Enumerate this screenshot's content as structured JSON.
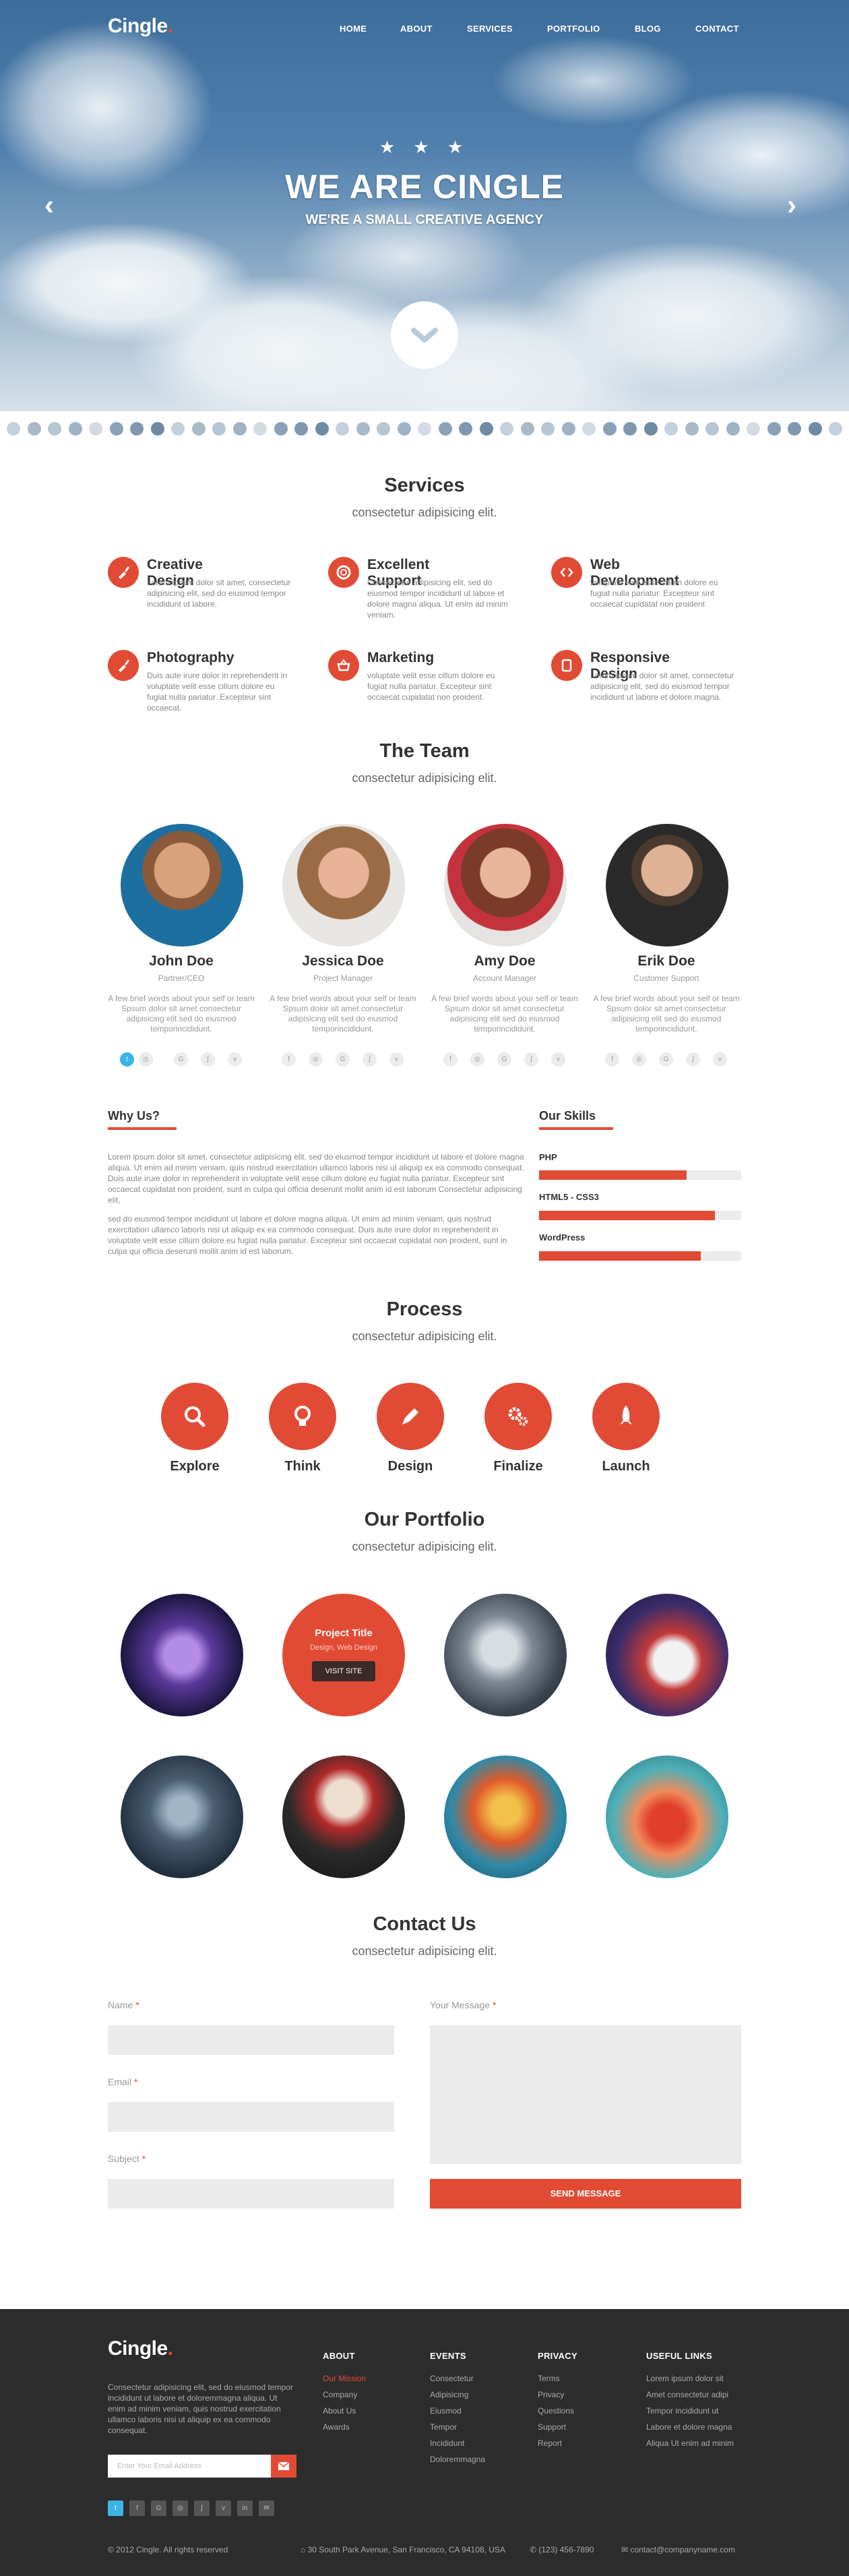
{
  "nav": {
    "logo": "Cingle",
    "logo_dot": ".",
    "items": [
      "HOME",
      "ABOUT",
      "SERVICES",
      "PORTFOLIO",
      "BLOG",
      "CONTACT"
    ]
  },
  "hero": {
    "stars": "★ ★ ★",
    "title": "WE ARE CINGLE",
    "subtitle": "WE'RE A SMALL CREATIVE AGENCY",
    "prev": "‹",
    "next": "›"
  },
  "services": {
    "title": "Services",
    "subtitle": "consectetur adipisicing elit.",
    "items": [
      {
        "title": "Creative Design",
        "text": "Lorem ipsum dolor sit amet, consectetur adipisicing elit, sed do eiusmod tempor incididunt ut labore.",
        "icon": "brush-icon"
      },
      {
        "title": "Excellent Support",
        "text": "Consectetur adipisicing elit, sed do eiusmod tempor incididunt ut labore et dolore magna aliqua. Ut enim ad minim veniam.",
        "icon": "lifebuoy-icon"
      },
      {
        "title": "Web Development",
        "text": "voluptate velit esse cillum dolore eu fugiat nulla pariatur. Excepteur sint occaecat cupidatat non proident",
        "icon": "code-icon"
      },
      {
        "title": "Photography",
        "text": "Duis aute irure dolor in reprehenderit in voluptate velit esse cillum dolore eu fugiat nulla pariatur. Excepteur sint occaecat.",
        "icon": "camera-icon"
      },
      {
        "title": "Marketing",
        "text": "voluptate velit esse cillum dolore eu fugiat nulla pariatur. Excepteur sint occaecat cupidatat non proident.",
        "icon": "basket-icon"
      },
      {
        "title": "Responsive Design",
        "text": "Lorem ipsum dolor sit amet, consectetur adipisicing elit, sed do eiusmod tempor incididunt ut labore et dolore magna.",
        "icon": "tablet-icon"
      }
    ]
  },
  "team": {
    "title": "The Team",
    "subtitle": "consectetur adipisicing elit.",
    "members": [
      {
        "name": "John Doe",
        "role": "Partner/CEO",
        "bio": "A few brief words about your self or team Spsum dolor sit amet consectetur adipisicing elit sed do eiusmod temporincididunt."
      },
      {
        "name": "Jessica Doe",
        "role": "Project Manager",
        "bio": "A few brief words about your self or team Spsum dolor sit amet consectetur adipisicing elit sed do eiusmod temporincididunt."
      },
      {
        "name": "Amy Doe",
        "role": "Account Manager",
        "bio": "A few brief words about your self or team Spsum dolor sit amet consectetur adipisicing elit sed do eiusmod temporincididunt."
      },
      {
        "name": "Erik Doe",
        "role": "Customer Support",
        "bio": "A few brief words about your self or team Spsum dolor sit amet consectetur adipisicing elit sed do eiusmod temporincididunt."
      }
    ],
    "social": [
      "t",
      "f",
      "◎",
      "G",
      "ʃ",
      "v"
    ]
  },
  "why": {
    "title": "Why Us?",
    "p1": "Lorem ipsum dolor sit amet, consectetur adipisicing elit, sed do eiusmod tempor incididunt ut labore et dolore magna aliqua. Ut enim ad minim veniam, quis nostrud exercitation ullamco laboris nisi ut aliquip ex ea commodo consequat. Duis aute irure dolor in reprehenderit in voluptate velit esse cillum dolore eu fugiat nulla pariatur. Excepteur sint occaecat cupidatat non proident, sunt in culpa qui officia deserunt mollit anim id est laborum Consectetur adipisicing elit,",
    "p2": "sed do eiusmod tempor incididunt ut labore et dolore magna aliqua. Ut enim ad minim veniam, quis nostrud exercitation ullamco laboris nisi ut aliquip ex ea commodo consequat. Duis aute irure dolor in reprehenderit in voluptate velit esse cillum dolore eu fugiat nulla pariatur. Excepteur sint occaecat cupidatat non proident, sunt in culpa qui officia deserunt mollit anim id est laborum."
  },
  "skills": {
    "title": "Our Skills",
    "items": [
      {
        "label": "PHP",
        "level": 0.73
      },
      {
        "label": "HTML5 - CSS3",
        "level": 0.87
      },
      {
        "label": "WordPress",
        "level": 0.8
      }
    ]
  },
  "process": {
    "title": "Process",
    "subtitle": "consectetur adipisicing elit.",
    "steps": [
      {
        "label": "Explore",
        "icon": "search-icon"
      },
      {
        "label": "Think",
        "icon": "lightbulb-icon"
      },
      {
        "label": "Design",
        "icon": "pen-icon"
      },
      {
        "label": "Finalize",
        "icon": "gears-icon"
      },
      {
        "label": "Launch",
        "icon": "rocket-icon"
      }
    ]
  },
  "portfolio": {
    "title": "Our Portfolio",
    "subtitle": "consectetur adipisicing elit.",
    "hover_title": "Project Title",
    "hover_sub": "Design, Web Design",
    "hover_btn": "VISIT SITE"
  },
  "contact": {
    "title": "Contact Us",
    "subtitle": "consectetur adipisicing elit.",
    "name_label": "Name",
    "email_label": "Email",
    "subject_label": "Subject",
    "message_label": "Your Message",
    "required": "*",
    "send": "SEND MESSAGE"
  },
  "footer": {
    "logo": "Cingle",
    "logo_dot": ".",
    "about_text": "Consectetur adipisicing elit, sed do eiusmod tempor incididunt ut labore et doloremmagna aliqua. Ut enim ad minim veniam, quis nostrud exercitation ullamco laboris nisi ut aliquip ex ea commodo consequat.",
    "email_placeholder": "Enter Your Email Address",
    "cols": [
      {
        "title": "ABOUT",
        "links": [
          "Our Mission",
          "Company",
          "About Us",
          "Awards"
        ]
      },
      {
        "title": "EVENTS",
        "links": [
          "Consectetur",
          "Adipisicing",
          "Eiusmod",
          "Tempor",
          "Incididunt",
          "Doloremmagna"
        ]
      },
      {
        "title": "PRIVACY",
        "links": [
          "Terms",
          "Privacy",
          "Questions",
          "Support",
          "Report"
        ]
      },
      {
        "title": "USEFUL LINKS",
        "links": [
          "Lorem ipsum dolor sit",
          "Amet consectetur adipi",
          "Tempor incididunt ut",
          "Labore et dolore magna",
          "Aliqua Ut enim ad minim"
        ]
      }
    ],
    "social": [
      "t",
      "f",
      "G",
      "◎",
      "ʃ",
      "v",
      "in",
      "✉"
    ],
    "copyright": "© 2012 Cingle. All rights reserved",
    "address": "30 South Park Avenue, San Francisco, CA 94108, USA",
    "phone": "(123) 456-7890",
    "email": "contact@companyname.com"
  },
  "colors": {
    "accent": "#e14b35",
    "footer_bg": "#2d2d2d",
    "twitter": "#3bb4e6"
  }
}
